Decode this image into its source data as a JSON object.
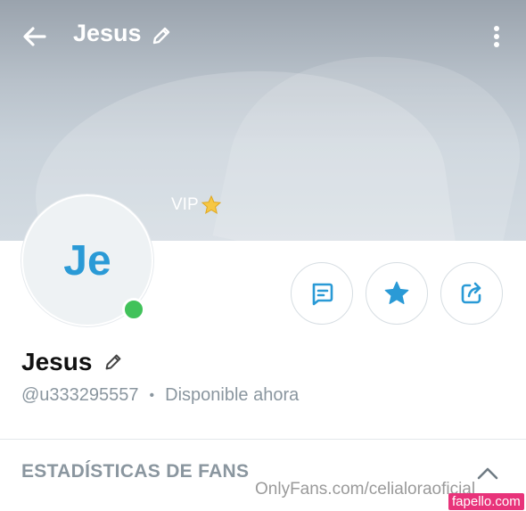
{
  "header": {
    "title": "Jesus",
    "back_icon": "arrow-left-icon",
    "edit_icon": "pencil-icon",
    "more_icon": "more-vertical-icon"
  },
  "cover": {
    "vip_label": "VIP",
    "vip_icon": "star-emoji-icon"
  },
  "profile": {
    "avatar_initials": "Je",
    "online": true,
    "name": "Jesus",
    "handle": "@u333295557",
    "separator": "•",
    "status": "Disponible ahora"
  },
  "actions": [
    {
      "name": "message",
      "icon": "message-icon"
    },
    {
      "name": "favorite",
      "icon": "star-icon"
    },
    {
      "name": "share",
      "icon": "share-icon"
    }
  ],
  "stats_section": {
    "title": "ESTADÍSTICAS DE FANS",
    "toggle_icon": "chevron-up-icon"
  },
  "overlay": {
    "watermark": "OnlyFans.com/celialoraoficial",
    "badge": "fapello.com"
  },
  "colors": {
    "accent": "#2a9ad6",
    "online": "#41c25a",
    "muted": "#8a969f",
    "badge": "#e8337a"
  }
}
